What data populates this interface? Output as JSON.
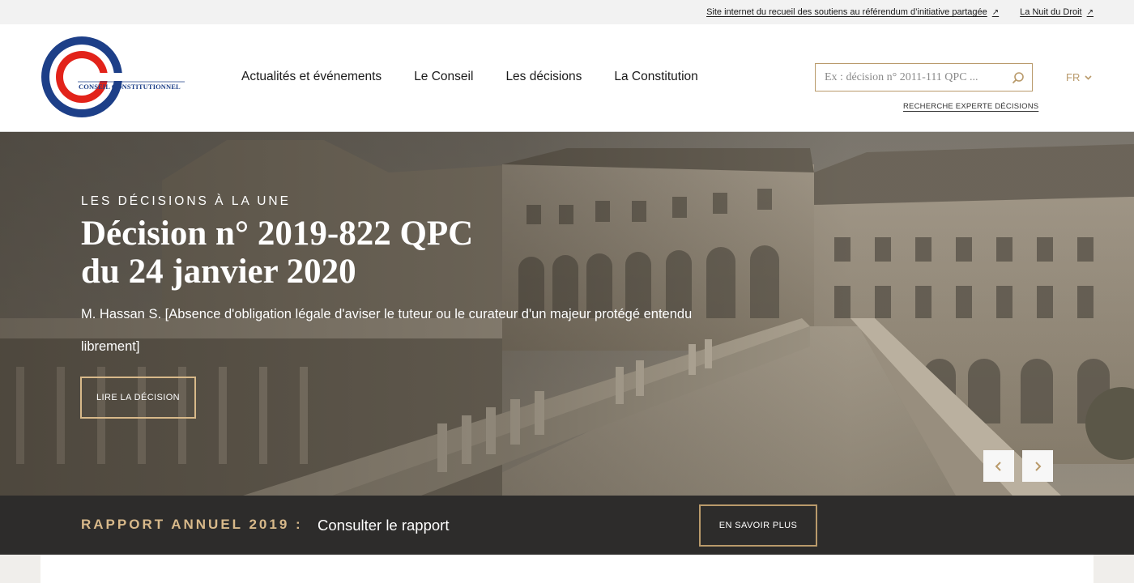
{
  "utility": {
    "links": [
      {
        "label": "Site internet du recueil des soutiens au référendum d’initiative partagée",
        "icon": "external-link-icon"
      },
      {
        "label": "La Nuit du Droit",
        "icon": "external-link-icon"
      }
    ]
  },
  "header": {
    "logo_text": "CONSEIL CONSTITUTIONNEL",
    "nav": [
      {
        "label": "Actualités et événements"
      },
      {
        "label": "Le Conseil"
      },
      {
        "label": "Les décisions"
      },
      {
        "label": "La Constitution"
      }
    ],
    "search": {
      "placeholder": "Ex : décision n° 2011-111 QPC ...",
      "icon": "search-icon"
    },
    "expert_link": "RECHERCHE EXPERTE DÉCISIONS",
    "language": "FR"
  },
  "hero": {
    "eyebrow": "LES DÉCISIONS À LA UNE",
    "title_line1": "Décision n° 2019-822 QPC",
    "title_line2": "du 24 janvier 2020",
    "description": "M. Hassan S. [Absence d'obligation légale d'aviser le tuteur ou le curateur d'un majeur protégé entendu librement]",
    "button_label": "LIRE LA DÉCISION",
    "prev_icon": "chevron-left-icon",
    "next_icon": "chevron-right-icon"
  },
  "report": {
    "label": "RAPPORT ANNUEL 2019 :",
    "link": "Consulter le rapport",
    "button_label": "EN SAVOIR PLUS"
  },
  "colors": {
    "gold": "#b99a6b",
    "dark": "#2d2c2b",
    "logo_blue": "#1d3f88",
    "logo_red": "#e2231a"
  }
}
